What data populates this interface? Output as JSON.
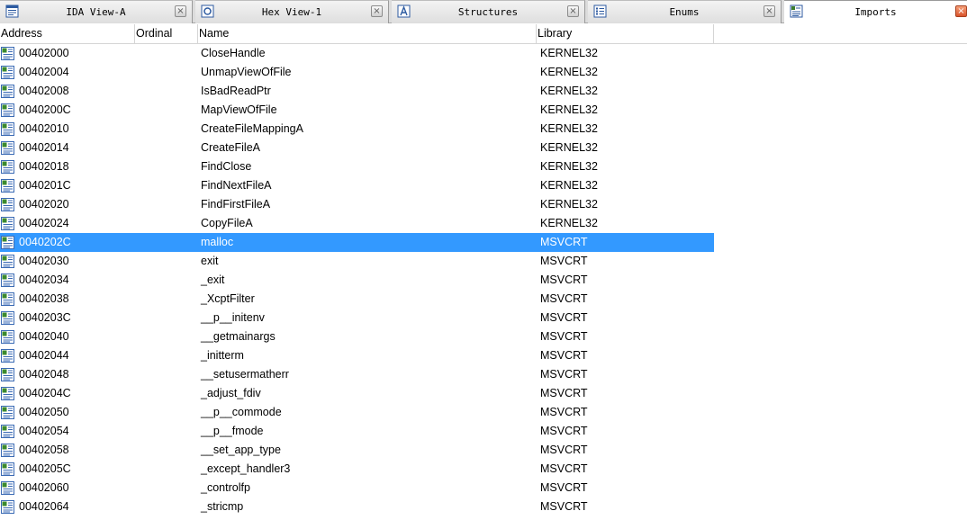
{
  "tabs": [
    {
      "label": "IDA View-A",
      "icon": "ida-view-icon",
      "active": false
    },
    {
      "label": "Hex View-1",
      "icon": "hex-view-icon",
      "active": false
    },
    {
      "label": "Structures",
      "icon": "structures-icon",
      "active": false
    },
    {
      "label": "Enums",
      "icon": "enums-icon",
      "active": false
    },
    {
      "label": "Imports",
      "icon": "imports-icon",
      "active": true
    }
  ],
  "table": {
    "columns": [
      "Address",
      "Ordinal",
      "Name",
      "Library"
    ],
    "selected_index": 10,
    "rows": [
      {
        "address": "00402000",
        "ordinal": "",
        "name": "CloseHandle",
        "library": "KERNEL32"
      },
      {
        "address": "00402004",
        "ordinal": "",
        "name": "UnmapViewOfFile",
        "library": "KERNEL32"
      },
      {
        "address": "00402008",
        "ordinal": "",
        "name": "IsBadReadPtr",
        "library": "KERNEL32"
      },
      {
        "address": "0040200C",
        "ordinal": "",
        "name": "MapViewOfFile",
        "library": "KERNEL32"
      },
      {
        "address": "00402010",
        "ordinal": "",
        "name": "CreateFileMappingA",
        "library": "KERNEL32"
      },
      {
        "address": "00402014",
        "ordinal": "",
        "name": "CreateFileA",
        "library": "KERNEL32"
      },
      {
        "address": "00402018",
        "ordinal": "",
        "name": "FindClose",
        "library": "KERNEL32"
      },
      {
        "address": "0040201C",
        "ordinal": "",
        "name": "FindNextFileA",
        "library": "KERNEL32"
      },
      {
        "address": "00402020",
        "ordinal": "",
        "name": "FindFirstFileA",
        "library": "KERNEL32"
      },
      {
        "address": "00402024",
        "ordinal": "",
        "name": "CopyFileA",
        "library": "KERNEL32"
      },
      {
        "address": "0040202C",
        "ordinal": "",
        "name": "malloc",
        "library": "MSVCRT"
      },
      {
        "address": "00402030",
        "ordinal": "",
        "name": "exit",
        "library": "MSVCRT"
      },
      {
        "address": "00402034",
        "ordinal": "",
        "name": "_exit",
        "library": "MSVCRT"
      },
      {
        "address": "00402038",
        "ordinal": "",
        "name": "_XcptFilter",
        "library": "MSVCRT"
      },
      {
        "address": "0040203C",
        "ordinal": "",
        "name": "__p__initenv",
        "library": "MSVCRT"
      },
      {
        "address": "00402040",
        "ordinal": "",
        "name": "__getmainargs",
        "library": "MSVCRT"
      },
      {
        "address": "00402044",
        "ordinal": "",
        "name": "_initterm",
        "library": "MSVCRT"
      },
      {
        "address": "00402048",
        "ordinal": "",
        "name": "__setusermatherr",
        "library": "MSVCRT"
      },
      {
        "address": "0040204C",
        "ordinal": "",
        "name": "_adjust_fdiv",
        "library": "MSVCRT"
      },
      {
        "address": "00402050",
        "ordinal": "",
        "name": "__p__commode",
        "library": "MSVCRT"
      },
      {
        "address": "00402054",
        "ordinal": "",
        "name": "__p__fmode",
        "library": "MSVCRT"
      },
      {
        "address": "00402058",
        "ordinal": "",
        "name": "__set_app_type",
        "library": "MSVCRT"
      },
      {
        "address": "0040205C",
        "ordinal": "",
        "name": "_except_handler3",
        "library": "MSVCRT"
      },
      {
        "address": "00402060",
        "ordinal": "",
        "name": "_controlfp",
        "library": "MSVCRT"
      },
      {
        "address": "00402064",
        "ordinal": "",
        "name": "_stricmp",
        "library": "MSVCRT"
      }
    ]
  },
  "colors": {
    "selection": "#3399ff",
    "active_close": "#d9532b"
  }
}
